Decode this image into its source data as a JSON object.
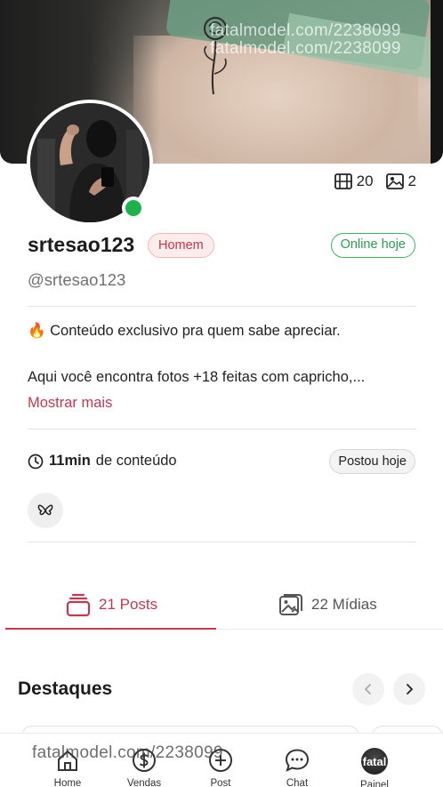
{
  "cover": {
    "watermark_lines": [
      "fatalmodel.com/2238099",
      "fatalmodel.com/2238099"
    ]
  },
  "counts": {
    "videos": "20",
    "images": "2",
    "video_icon": "film-icon",
    "image_icon": "image-icon"
  },
  "profile": {
    "name": "srtesao123",
    "gender_tag": "Homem",
    "online_tag": "Online hoje",
    "handle": "@srtesao123"
  },
  "bio": {
    "emoji": "🔥",
    "line1": "Conteúdo exclusivo pra quem sabe apreciar.",
    "line2": "Aqui você encontra fotos +18 feitas com capricho,...",
    "more_label": "Mostrar mais"
  },
  "content": {
    "duration_value": "11min",
    "duration_suffix": "de conteúdo",
    "posted_label": "Postou hoje"
  },
  "tabs": [
    {
      "label": "21 Posts",
      "icon": "stack-icon",
      "active": true
    },
    {
      "label": "22 Mídias",
      "icon": "gallery-icon",
      "active": false
    }
  ],
  "highlights": {
    "title": "Destaques"
  },
  "bottom_nav": {
    "watermark": "fatalmodel.com/2238099",
    "items": [
      {
        "label": "Home",
        "icon": "home-icon"
      },
      {
        "label": "Vendas",
        "icon": "dollar-icon"
      },
      {
        "label": "Post",
        "icon": "plus-circle-icon"
      },
      {
        "label": "Chat",
        "icon": "chat-icon"
      },
      {
        "label": "Painel",
        "icon": "avatar-icon",
        "avatar_text": "fatal"
      }
    ]
  },
  "colors": {
    "accent": "#c2394f",
    "online": "#1db34a",
    "online_text": "#2a9c4c"
  }
}
